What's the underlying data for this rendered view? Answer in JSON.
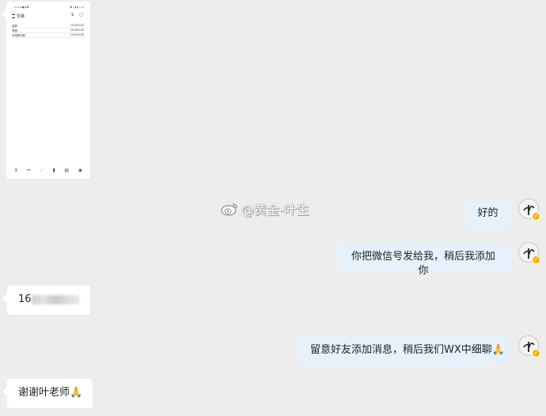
{
  "phone_screenshot": {
    "status_left": "11:16 ■ ▮ ◘ ·",
    "status_right": "◘ ▯ ▮ ▮ ▯ 91",
    "title": "交易",
    "tool_icons": [
      "⇅",
      "▢"
    ],
    "rows": [
      {
        "key": "结算:",
        "value": "10,000.00"
      },
      {
        "key": "净值:",
        "value": "10,000.00"
      },
      {
        "key": "可用预付款:",
        "value": "10,000.00"
      }
    ],
    "bottom_icons": [
      "⥮",
      "ꕹ",
      "⟋",
      "▮",
      "▤",
      "◉"
    ]
  },
  "messages": [
    {
      "side": "right",
      "text": "好的"
    },
    {
      "side": "right",
      "text": "你把微信号发给我，稍后我添加你"
    },
    {
      "side": "left",
      "text": "16",
      "redacted": true
    },
    {
      "side": "right",
      "text": "留意好友添加消息，稍后我们WX中细聊",
      "emoji": "🙏"
    },
    {
      "side": "left",
      "text": "谢谢叶老师",
      "emoji": "🙏"
    }
  ],
  "watermark": {
    "text": "@黄金-叶生"
  },
  "colors": {
    "background": "#ededed",
    "right_bubble": "#e6f1fb",
    "left_bubble": "#ffffff",
    "badge": "#f5b400"
  }
}
